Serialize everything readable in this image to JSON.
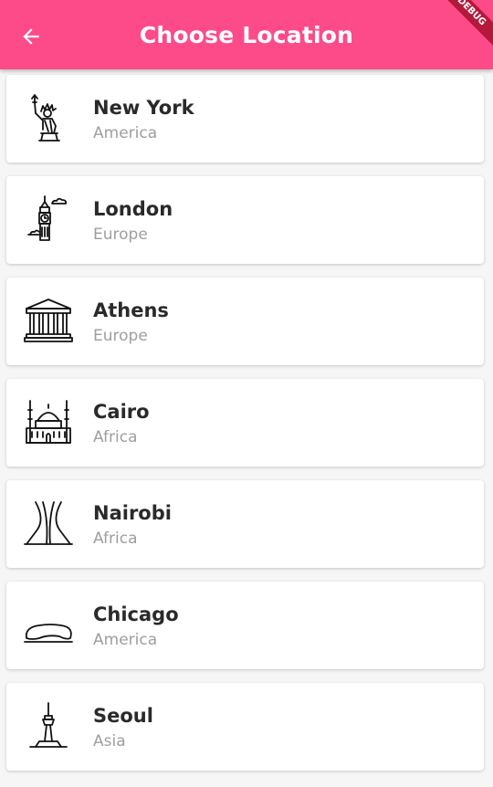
{
  "app_bar": {
    "title": "Choose Location",
    "back_icon": "arrow-left-icon",
    "background": "#fd4b89"
  },
  "debug_banner": "DEBUG",
  "locations": [
    {
      "city": "New York",
      "region": "America",
      "icon": "statue-of-liberty-icon"
    },
    {
      "city": "London",
      "region": "Europe",
      "icon": "big-ben-icon"
    },
    {
      "city": "Athens",
      "region": "Europe",
      "icon": "parthenon-icon"
    },
    {
      "city": "Cairo",
      "region": "Africa",
      "icon": "mosque-icon"
    },
    {
      "city": "Nairobi",
      "region": "Africa",
      "icon": "monument-icon"
    },
    {
      "city": "Chicago",
      "region": "America",
      "icon": "cloud-gate-bean-icon"
    },
    {
      "city": "Seoul",
      "region": "Asia",
      "icon": "n-seoul-tower-icon"
    }
  ]
}
